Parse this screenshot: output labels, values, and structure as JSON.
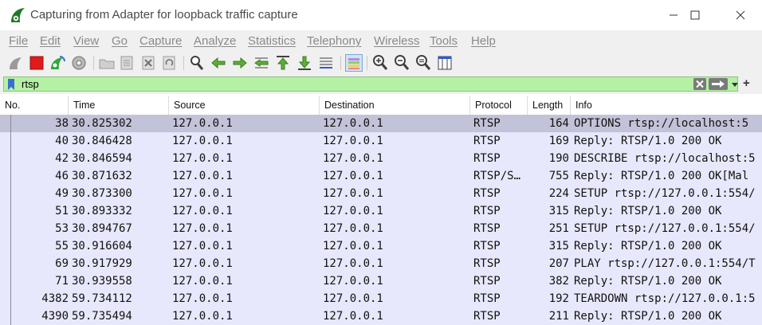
{
  "window": {
    "title": "Capturing from Adapter for loopback traffic capture",
    "icon": "wireshark-fin-icon",
    "controls": [
      "minimize-icon",
      "maximize-icon",
      "close-icon"
    ]
  },
  "menu": [
    "File",
    "Edit",
    "View",
    "Go",
    "Capture",
    "Analyze",
    "Statistics",
    "Telephony",
    "Wireless",
    "Tools",
    "Help"
  ],
  "toolbar": {
    "icons": [
      "start-capture-icon",
      "stop-capture-icon",
      "restart-capture-icon",
      "capture-options-icon",
      "open-file-icon",
      "save-file-icon",
      "close-file-icon",
      "reload-file-icon",
      "find-packet-icon",
      "go-back-icon",
      "go-forward-icon",
      "go-to-packet-icon",
      "go-first-packet-icon",
      "go-last-packet-icon",
      "autoscroll-icon",
      "colorize-icon",
      "zoom-in-icon",
      "zoom-out-icon",
      "normal-size-icon",
      "resize-columns-icon"
    ]
  },
  "filter": {
    "value": "rtsp",
    "background": "#b4f1a4"
  },
  "columns": [
    "No.",
    "Time",
    "Source",
    "Destination",
    "Protocol",
    "Length",
    "Info"
  ],
  "rows": [
    {
      "no": "38",
      "time": "30.825302",
      "source": "127.0.0.1",
      "destination": "127.0.0.1",
      "protocol": "RTSP",
      "length": "164",
      "info": "OPTIONS rtsp://localhost:5",
      "selected": true
    },
    {
      "no": "40",
      "time": "30.846428",
      "source": "127.0.0.1",
      "destination": "127.0.0.1",
      "protocol": "RTSP",
      "length": "169",
      "info": "Reply: RTSP/1.0 200 OK"
    },
    {
      "no": "42",
      "time": "30.846594",
      "source": "127.0.0.1",
      "destination": "127.0.0.1",
      "protocol": "RTSP",
      "length": "190",
      "info": "DESCRIBE rtsp://localhost:5"
    },
    {
      "no": "46",
      "time": "30.871632",
      "source": "127.0.0.1",
      "destination": "127.0.0.1",
      "protocol": "RTSP/S…",
      "length": "755",
      "info": "Reply: RTSP/1.0 200 OK[Mal"
    },
    {
      "no": "49",
      "time": "30.873300",
      "source": "127.0.0.1",
      "destination": "127.0.0.1",
      "protocol": "RTSP",
      "length": "224",
      "info": "SETUP rtsp://127.0.0.1:554/"
    },
    {
      "no": "51",
      "time": "30.893332",
      "source": "127.0.0.1",
      "destination": "127.0.0.1",
      "protocol": "RTSP",
      "length": "315",
      "info": "Reply: RTSP/1.0 200 OK"
    },
    {
      "no": "53",
      "time": "30.894767",
      "source": "127.0.0.1",
      "destination": "127.0.0.1",
      "protocol": "RTSP",
      "length": "251",
      "info": "SETUP rtsp://127.0.0.1:554/"
    },
    {
      "no": "55",
      "time": "30.916604",
      "source": "127.0.0.1",
      "destination": "127.0.0.1",
      "protocol": "RTSP",
      "length": "315",
      "info": "Reply: RTSP/1.0 200 OK"
    },
    {
      "no": "69",
      "time": "30.917929",
      "source": "127.0.0.1",
      "destination": "127.0.0.1",
      "protocol": "RTSP",
      "length": "207",
      "info": "PLAY rtsp://127.0.0.1:554/T"
    },
    {
      "no": "71",
      "time": "30.939558",
      "source": "127.0.0.1",
      "destination": "127.0.0.1",
      "protocol": "RTSP",
      "length": "382",
      "info": "Reply: RTSP/1.0 200 OK"
    },
    {
      "no": "4382",
      "time": "59.734112",
      "source": "127.0.0.1",
      "destination": "127.0.0.1",
      "protocol": "RTSP",
      "length": "192",
      "info": "TEARDOWN rtsp://127.0.0.1:5"
    },
    {
      "no": "4390",
      "time": "59.735494",
      "source": "127.0.0.1",
      "destination": "127.0.0.1",
      "protocol": "RTSP",
      "length": "211",
      "info": "Reply: RTSP/1.0 200 OK"
    }
  ],
  "colors": {
    "row_background": "#e8e8fc",
    "selected_row": "#c2c2d8",
    "filter_valid": "#b4f1a4"
  }
}
